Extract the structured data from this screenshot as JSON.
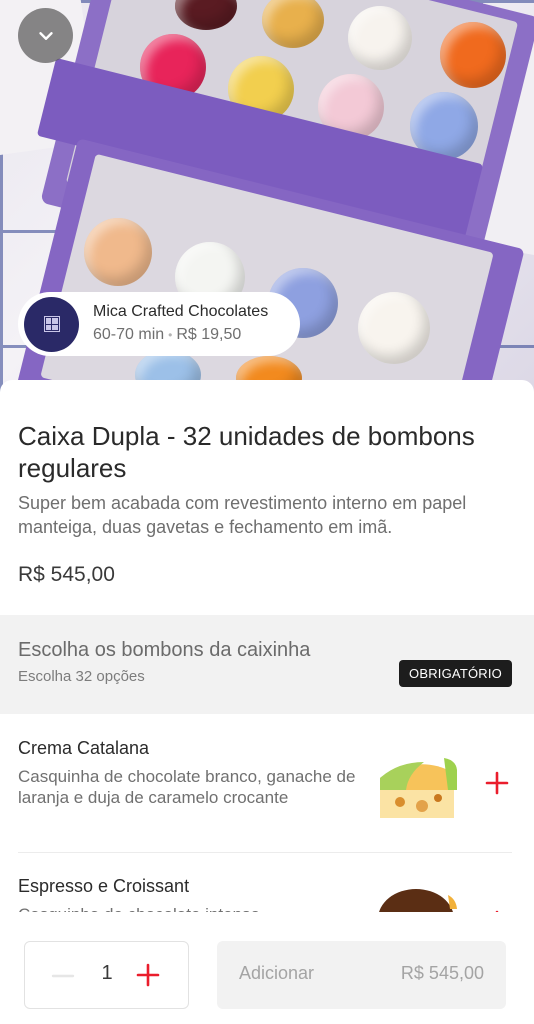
{
  "merchant": {
    "name": "Mica Crafted Chocolates",
    "eta": "60-70 min",
    "separator": "•",
    "delivery_fee": "R$ 19,50"
  },
  "product": {
    "title": "Caixa Dupla - 32 unidades de bombons regulares",
    "description": "Super bem acabada com revestimento interno em papel manteiga, duas gavetas e fechamento em imã.",
    "price": "R$ 545,00"
  },
  "section": {
    "title": "Escolha os bombons da caixinha",
    "subtitle": "Escolha 32 opções",
    "badge": "OBRIGATÓRIO"
  },
  "options": [
    {
      "name": "Crema Catalana",
      "description": "Casquinha de chocolate branco, ganache de laranja e duja de caramelo crocante"
    },
    {
      "name": "Espresso e Croissant",
      "description": "Casquinha de chocolate intenso"
    }
  ],
  "footer": {
    "quantity": "1",
    "add_label": "Adicionar",
    "add_price": "R$ 545,00"
  },
  "colors": {
    "accent": "#ea1d2c",
    "badge_bg": "#1d1d1d",
    "box_purple": "#8566c3",
    "logo_bg": "#2a2967"
  },
  "icons": {
    "collapse": "chevron-down-icon",
    "add": "plus-icon",
    "remove": "minus-icon"
  }
}
